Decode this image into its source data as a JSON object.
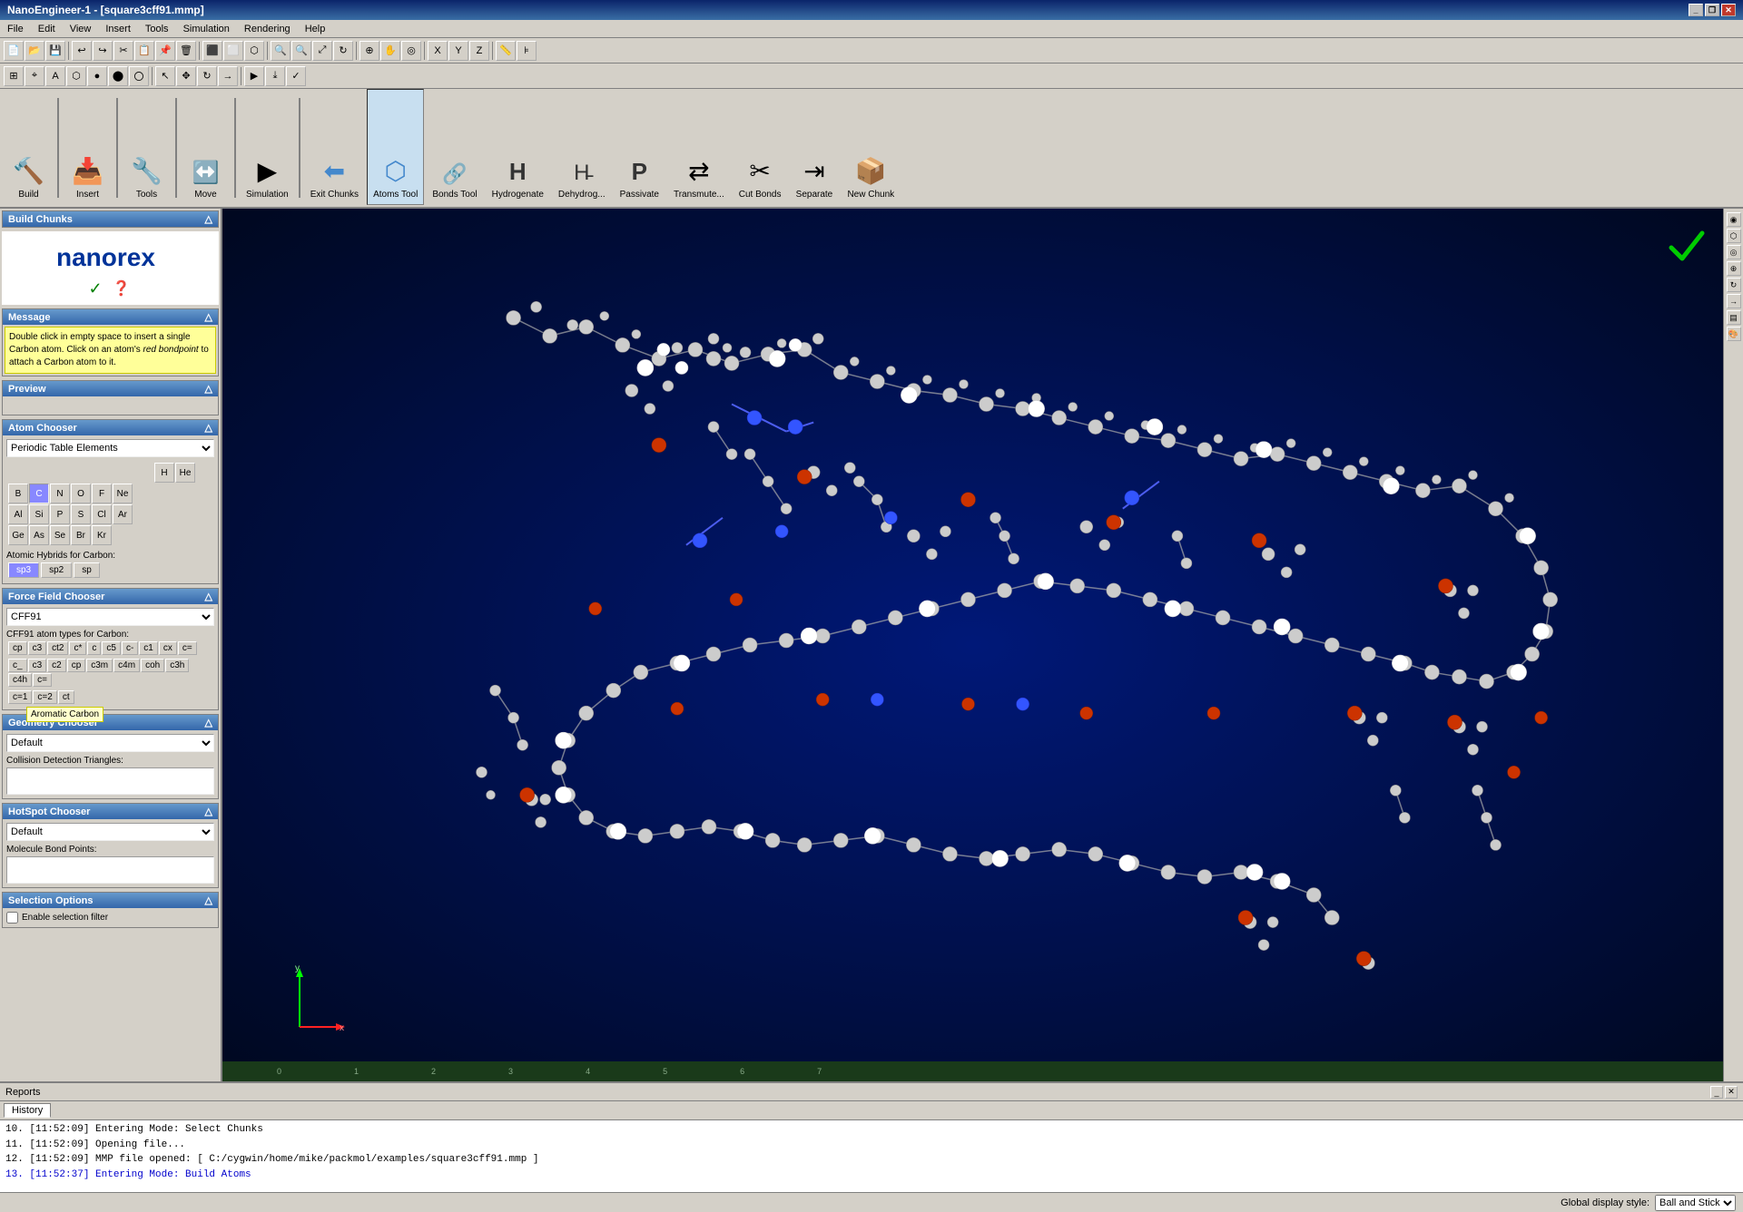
{
  "titlebar": {
    "title": "NanoEngineer-1 - [square3cff91.mmp]",
    "controls": [
      "minimize",
      "restore",
      "close"
    ]
  },
  "menubar": {
    "items": [
      "File",
      "Edit",
      "View",
      "Insert",
      "Tools",
      "Simulation",
      "Rendering",
      "Help"
    ]
  },
  "bigtoolbar": {
    "tools": [
      {
        "id": "build",
        "label": "Build",
        "icon": "🔨"
      },
      {
        "id": "insert",
        "label": "Insert",
        "icon": "📥"
      },
      {
        "id": "tools",
        "label": "Tools",
        "icon": "🔧"
      },
      {
        "id": "move",
        "label": "Move",
        "icon": "↔"
      },
      {
        "id": "simulation",
        "label": "Simulation",
        "icon": "▶"
      },
      {
        "id": "exit-chunks",
        "label": "Exit Chunks",
        "icon": "⬅"
      },
      {
        "id": "atoms-tool",
        "label": "Atoms Tool",
        "icon": "⬡"
      },
      {
        "id": "bonds-tool",
        "label": "Bonds Tool",
        "icon": "🔗"
      },
      {
        "id": "hydrogenate",
        "label": "Hydrogenate",
        "icon": "H"
      },
      {
        "id": "dehydrogenate",
        "label": "Dehydrog...",
        "icon": "H̶"
      },
      {
        "id": "passivate",
        "label": "Passivate",
        "icon": "P"
      },
      {
        "id": "transmute",
        "label": "Transmute...",
        "icon": "⇄"
      },
      {
        "id": "cut-bonds",
        "label": "Cut Bonds",
        "icon": "✂"
      },
      {
        "id": "separate",
        "label": "Separate",
        "icon": "⇥"
      },
      {
        "id": "new-chunk",
        "label": "New Chunk",
        "icon": "📦"
      }
    ]
  },
  "leftpanel": {
    "title": "Build Chunks",
    "message": {
      "header": "Message",
      "text": "Double click in empty space to insert a single Carbon atom. Click on an atom's red bondpoint to attach a Carbon atom to it."
    },
    "preview": {
      "header": "Preview"
    },
    "atom_chooser": {
      "header": "Atom Chooser",
      "dropdown": "Periodic Table Elements",
      "elements": [
        {
          "symbol": "",
          "row": 1,
          "col": 1
        },
        {
          "symbol": "",
          "row": 1,
          "col": 2
        },
        {
          "symbol": "",
          "row": 1,
          "col": 3
        },
        {
          "symbol": "",
          "row": 1,
          "col": 4
        },
        {
          "symbol": "",
          "row": 1,
          "col": 5
        },
        {
          "symbol": "",
          "row": 1,
          "col": 6
        },
        {
          "symbol": "",
          "row": 1,
          "col": 7
        },
        {
          "symbol": "H",
          "row": 1,
          "col": 8
        },
        {
          "symbol": "He",
          "row": 1,
          "col": 9
        },
        {
          "symbol": "B",
          "row": 2,
          "col": 1
        },
        {
          "symbol": "C",
          "row": 2,
          "col": 2,
          "selected": true
        },
        {
          "symbol": "N",
          "row": 2,
          "col": 3
        },
        {
          "symbol": "O",
          "row": 2,
          "col": 4
        },
        {
          "symbol": "F",
          "row": 2,
          "col": 5
        },
        {
          "symbol": "Ne",
          "row": 2,
          "col": 6
        },
        {
          "symbol": "Al",
          "row": 3,
          "col": 1
        },
        {
          "symbol": "Si",
          "row": 3,
          "col": 2
        },
        {
          "symbol": "P",
          "row": 3,
          "col": 3
        },
        {
          "symbol": "S",
          "row": 3,
          "col": 4
        },
        {
          "symbol": "Cl",
          "row": 3,
          "col": 5
        },
        {
          "symbol": "Ar",
          "row": 3,
          "col": 6
        },
        {
          "symbol": "Ge",
          "row": 4,
          "col": 1
        },
        {
          "symbol": "As",
          "row": 4,
          "col": 2
        },
        {
          "symbol": "Se",
          "row": 4,
          "col": 3
        },
        {
          "symbol": "Br",
          "row": 4,
          "col": 4
        },
        {
          "symbol": "Kr",
          "row": 4,
          "col": 5
        }
      ],
      "hybrids_label": "Atomic Hybrids for Carbon:",
      "hybrids": [
        "sp3",
        "sp2",
        "sp"
      ],
      "hybrids_selected": "sp3"
    },
    "forcefield": {
      "header": "Force Field Chooser",
      "dropdown": "CFF91",
      "label": "CFF91 atom types for Carbon:",
      "types_row1": [
        "cp",
        "c3",
        "ct2",
        "c*",
        "c",
        "c5",
        "c-",
        "c1",
        "cx",
        "c="
      ],
      "types_row2": [
        "c_",
        "c3",
        "c2",
        "cp_",
        "c3m",
        "c4m",
        "coh",
        "c3h",
        "c4h",
        "c="
      ],
      "types_row3": [
        "c=1",
        "c=2",
        "ct"
      ],
      "tooltip": "Aromatic Carbon"
    },
    "geometry": {
      "header": "Geometry Chooser",
      "dropdown": "Default",
      "label": "Collision Detection Triangles:"
    },
    "hotspot": {
      "header": "HotSpot Chooser",
      "dropdown": "Default",
      "label": "Molecule Bond Points:"
    },
    "selection": {
      "header": "Selection Options",
      "checkbox_label": "Enable selection filter"
    }
  },
  "viewport": {
    "background_color": "#001060"
  },
  "reports": {
    "header": "Reports",
    "tabs": [
      "History"
    ],
    "lines": [
      {
        "time": "11:52:09",
        "text": "Entering Mode: Select Chunks",
        "highlight": false
      },
      {
        "time": "11:52:09",
        "text": "Opening file...",
        "highlight": false
      },
      {
        "time": "11:52:09",
        "text": "MMP file opened: [ C:/cygwin/home/mike/packmol/examples/square3cff91.mmp ]",
        "highlight": false
      },
      {
        "time": "11:52:37",
        "text": "Entering Mode: Build Atoms",
        "highlight": true
      }
    ]
  },
  "statusbar": {
    "display_style_label": "Global display style:",
    "display_style_value": "Ball and Stick"
  }
}
